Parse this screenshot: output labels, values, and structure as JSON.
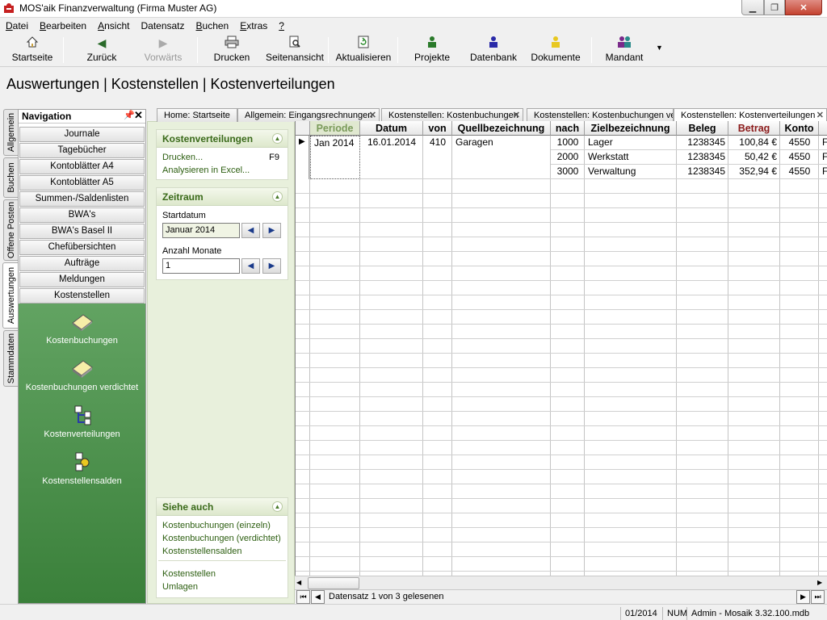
{
  "window": {
    "title": "MOS'aik Finanzverwaltung (Firma Muster AG)"
  },
  "menu": [
    {
      "first": "D",
      "rest": "atei"
    },
    {
      "first": "B",
      "rest": "earbeiten"
    },
    {
      "first": "A",
      "rest": "nsicht"
    },
    {
      "first": "D",
      "rest": "atensatz",
      "prefix": "Da",
      "tail": "tensatz"
    },
    {
      "first": "B",
      "rest": "uchen"
    },
    {
      "first": "E",
      "rest": "xtras"
    },
    {
      "first": "?",
      "rest": ""
    }
  ],
  "toolbar": {
    "home": "Startseite",
    "back": "Zurück",
    "forward": "Vorwärts",
    "print": "Drucken",
    "preview": "Seitenansicht",
    "refresh": "Aktualisieren",
    "projects": "Projekte",
    "database": "Datenbank",
    "documents": "Dokumente",
    "client": "Mandant"
  },
  "heading": "Auswertungen | Kostenstellen | Kostenverteilungen",
  "vtabs": [
    "Allgemein",
    "Buchen",
    "Offene Posten",
    "Auswertungen",
    "Stammdaten"
  ],
  "navigation": {
    "title": "Navigation",
    "buttons": [
      "Journale",
      "Tagebücher",
      "Kontoblätter A4",
      "Kontoblätter A5",
      "Summen-/Saldenlisten",
      "BWA's",
      "BWA's Basel II",
      "Chefübersichten",
      "Aufträge",
      "Meldungen",
      "Kostenstellen"
    ],
    "items": [
      "Kostenbuchungen",
      "Kostenbuchungen verdichtet",
      "Kostenverteilungen",
      "Kostenstellensalden"
    ]
  },
  "taskpane": {
    "section1": {
      "title": "Kostenverteilungen",
      "print": "Drucken...",
      "print_key": "F9",
      "excel": "Analysieren in Excel..."
    },
    "section2": {
      "title": "Zeitraum",
      "start_label": "Startdatum",
      "start_value": "Januar 2014",
      "months_label": "Anzahl Monate",
      "months_value": "1"
    },
    "section3": {
      "title": "Siehe auch",
      "links": [
        "Kostenbuchungen (einzeln)",
        "Kostenbuchungen (verdichtet)",
        "Kostenstellensalden"
      ],
      "links2": [
        "Kostenstellen",
        "Umlagen"
      ]
    }
  },
  "doc_tabs": [
    "Home: Startseite",
    "Allgemein: Eingangsrechnungen",
    "Kostenstellen: Kostenbuchungen",
    "Kostenstellen: Kostenbuchungen ve",
    "Kostenstellen: Kostenverteilungen"
  ],
  "grid": {
    "columns": [
      "Periode",
      "Datum",
      "von",
      "Quellbezeichnung",
      "nach",
      "Zielbezeichnung",
      "Beleg",
      "Betrag",
      "Konto"
    ],
    "group": {
      "periode": "Jan 2014",
      "datum": "16.01.2014",
      "von": "410",
      "quelle": "Garagen"
    },
    "rows": [
      {
        "nach": "1000",
        "ziel": "Lager",
        "beleg": "1238345",
        "betrag": "100,84 €",
        "konto": "4550",
        "extra": "F"
      },
      {
        "nach": "2000",
        "ziel": "Werkstatt",
        "beleg": "1238345",
        "betrag": "50,42 €",
        "konto": "4550",
        "extra": "F"
      },
      {
        "nach": "3000",
        "ziel": "Verwaltung",
        "beleg": "1238345",
        "betrag": "352,94 €",
        "konto": "4550",
        "extra": "F"
      }
    ],
    "record_info": "Datensatz 1 von 3 gelesenen"
  },
  "status": {
    "period": "01/2014",
    "num": "NUM",
    "user": "Admin - Mosaik 3.32.100.mdb"
  }
}
